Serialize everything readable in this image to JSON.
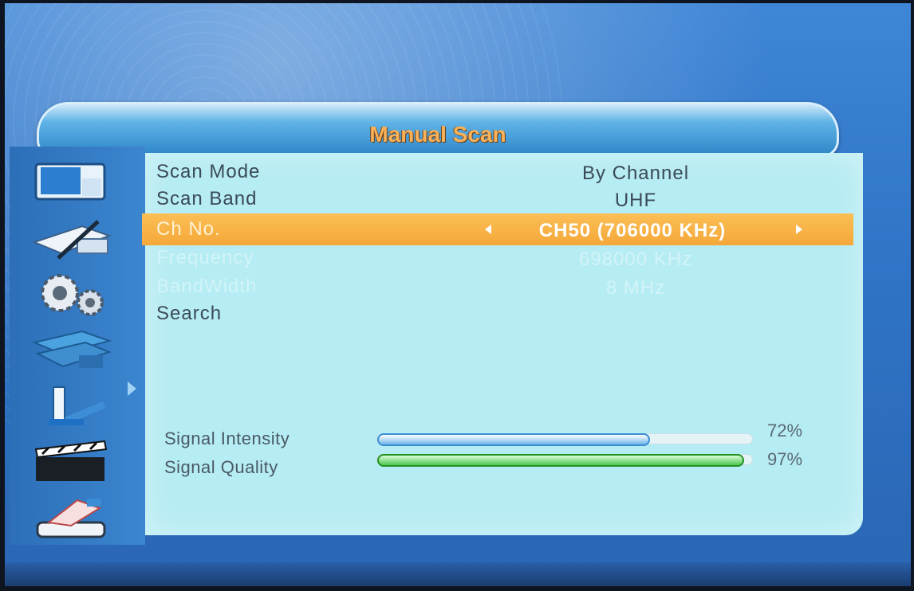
{
  "header": {
    "title": "Manual Scan"
  },
  "sidebar": {
    "icons": [
      {
        "name": "picture-settings-icon"
      },
      {
        "name": "installation-icon"
      },
      {
        "name": "system-gears-icon"
      },
      {
        "name": "tools-icon"
      },
      {
        "name": "media-icon"
      },
      {
        "name": "clapper-icon"
      },
      {
        "name": "usb-recorder-icon"
      }
    ]
  },
  "settings": [
    {
      "label": "Scan Mode",
      "value": "By Channel",
      "state": "normal"
    },
    {
      "label": "Scan Band",
      "value": "UHF",
      "state": "normal"
    },
    {
      "label": "Ch No.",
      "value": "CH50 (706000 KHz)",
      "state": "selected"
    },
    {
      "label": "Frequency",
      "value": "698000 KHz",
      "state": "disabled"
    },
    {
      "label": "BandWidth",
      "value": "8 MHz",
      "state": "disabled"
    },
    {
      "label": "Search",
      "value": "",
      "state": "normal"
    }
  ],
  "signal": {
    "intensity": {
      "label": "Signal Intensity",
      "percent_text": "72%",
      "fraction": 0.72
    },
    "quality": {
      "label": "Signal Quality",
      "percent_text": "97%",
      "fraction": 0.97
    }
  },
  "colors": {
    "highlight": "#f5a739",
    "panel": "#b6ecf3",
    "title_text": "#f9b25a",
    "intensity_bar": "#3b8dd4",
    "quality_bar": "#249124"
  }
}
